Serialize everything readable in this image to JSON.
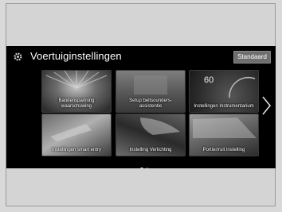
{
  "header": {
    "title": "Voertuiginstellingen",
    "standard_button": "Standaard"
  },
  "tiles": [
    {
      "label": "Bandenspanning waarschuwing",
      "icon": "tire-icon"
    },
    {
      "label": "Setup beltsounders-assistentie",
      "icon": "seatbelt-icon"
    },
    {
      "label": "Instellingen Instrumentarium",
      "icon": "gauge-icon",
      "display_value": "60"
    },
    {
      "label": "Instellingen smart entry",
      "icon": "key-icon"
    },
    {
      "label": "Instelling Verlichting",
      "icon": "headlight-icon"
    },
    {
      "label": "Portier/ruit instelling",
      "icon": "door-icon"
    }
  ],
  "pagination": {
    "pages": 2,
    "current": 1
  },
  "icons": {
    "settings": "gear-icon",
    "next": "chevron-right-icon"
  }
}
